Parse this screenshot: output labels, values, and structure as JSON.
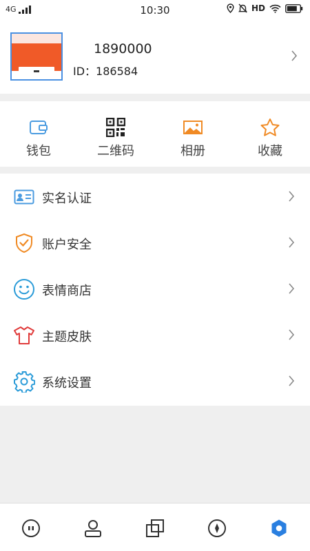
{
  "status_bar": {
    "network": "4G",
    "time": "10:30",
    "hd": "HD"
  },
  "profile": {
    "name": "1890000",
    "id_line": "ID：186584"
  },
  "quick_actions": [
    {
      "label": "钱包",
      "icon": "wallet-icon",
      "color": "#4a9be0"
    },
    {
      "label": "二维码",
      "icon": "qr-code-icon",
      "color": "#222222"
    },
    {
      "label": "相册",
      "icon": "photo-album-icon",
      "color": "#f08a24"
    },
    {
      "label": "收藏",
      "icon": "star-icon",
      "color": "#f08a24"
    }
  ],
  "menu": [
    {
      "label": "实名认证",
      "icon": "id-card-icon",
      "color": "#4a9be0"
    },
    {
      "label": "账户安全",
      "icon": "shield-check-icon",
      "color": "#f08a24"
    },
    {
      "label": "表情商店",
      "icon": "smiley-icon",
      "color": "#2a9bd8"
    },
    {
      "label": "主题皮肤",
      "icon": "shirt-icon",
      "color": "#e03a3a"
    },
    {
      "label": "系统设置",
      "icon": "gear-icon",
      "color": "#2a9bd8"
    }
  ],
  "tabbar": [
    {
      "icon": "chat-icon",
      "active": false
    },
    {
      "icon": "contacts-icon",
      "active": false
    },
    {
      "icon": "squares-icon",
      "active": false
    },
    {
      "icon": "compass-icon",
      "active": false
    },
    {
      "icon": "settings-hex-icon",
      "active": true
    }
  ],
  "colors": {
    "accent": "#2a7fe0",
    "background": "#efefef"
  }
}
